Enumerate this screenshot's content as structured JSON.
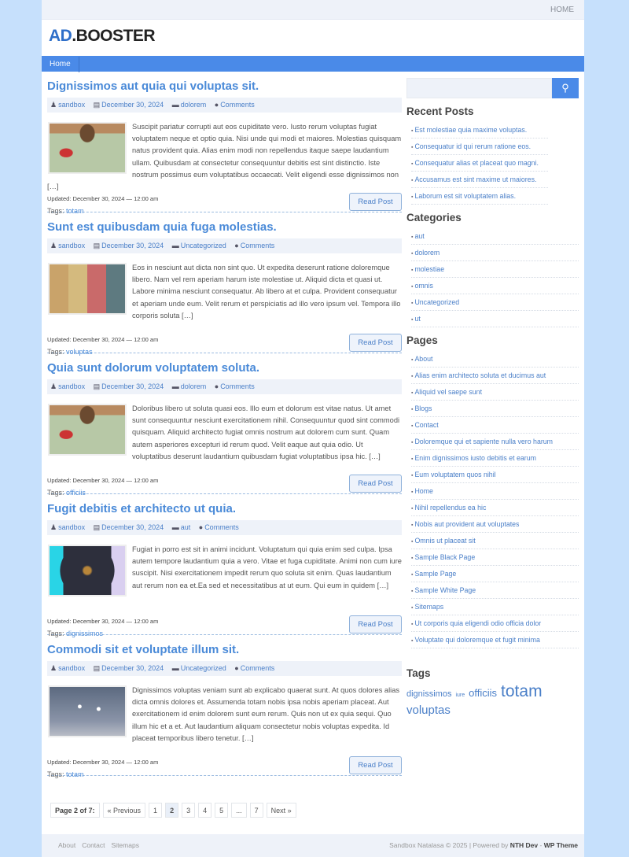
{
  "topnav": {
    "home": "HOME"
  },
  "logo": {
    "part1": "AD",
    "part2": ".BOOSTER"
  },
  "nav": {
    "home": "Home"
  },
  "posts": [
    {
      "title": "Dignissimos aut quia qui voluptas sit.",
      "author": "sandbox",
      "date": "December 30, 2024",
      "category": "dolorem",
      "comments": "Comments",
      "excerpt": "Suscipit pariatur corrupti aut eos cupiditate vero. Iusto rerum voluptas fugiat voluptatem neque et optio quia. Nisi unde qui modi et maiores. Molestias quisquam natus provident quia. Alias enim modi non repellendus itaque saepe laudantium ullam. Quibusdam at consectetur consequuntur debitis est sint distinctio. Iste nostrum possimus eum voluptatibus occaecati. Velit eligendi esse dignissimos non […]",
      "updated": "Updated: December 30, 2024 — 12:00 am",
      "tags_label": "Tags:",
      "tag": "totam",
      "read": "Read Post",
      "image": "feet"
    },
    {
      "title": "Sunt est quibusdam quia fuga molestias.",
      "author": "sandbox",
      "date": "December 30, 2024",
      "category": "Uncategorized",
      "comments": "Comments",
      "excerpt": "Eos in nesciunt aut dicta non sint quo. Ut expedita deserunt ratione doloremque libero. Nam vel rem aperiam harum iste molestiae ut. Aliquid dicta et quasi ut. Labore minima nesciunt consequatur. Ab libero at et culpa. Provident consequatur et aperiam unde eum. Velit rerum et perspiciatis ad illo vero ipsum vel. Tempora illo corporis soluta […]",
      "updated": "Updated: December 30, 2024 — 12:00 am",
      "tags_label": "Tags:",
      "tag": "voluptas",
      "read": "Read Post",
      "image": "building"
    },
    {
      "title": "Quia sunt dolorum voluptatem soluta.",
      "author": "sandbox",
      "date": "December 30, 2024",
      "category": "dolorem",
      "comments": "Comments",
      "excerpt": "Doloribus libero ut soluta quasi eos. Illo eum et dolorum est vitae natus. Ut amet sunt consequuntur nesciunt exercitationem nihil. Consequuntur quod sint commodi quisquam. Aliquid architecto fugiat omnis nostrum aut dolorem cum sunt. Quam autem asperiores excepturi id rerum quod. Velit eaque aut quia odio. Ut voluptatibus deserunt laudantium quibusdam fugiat voluptatibus ipsa hic. […]",
      "updated": "Updated: December 30, 2024 — 12:00 am",
      "tags_label": "Tags:",
      "tag": "officiis",
      "read": "Read Post",
      "image": "feet"
    },
    {
      "title": "Fugit debitis et architecto ut quia.",
      "author": "sandbox",
      "date": "December 30, 2024",
      "category": "aut",
      "comments": "Comments",
      "excerpt": "Fugiat in porro est sit in animi incidunt. Voluptatum qui quia enim sed culpa. Ipsa autem tempore laudantium quia a vero. Vitae et fuga cupiditate. Animi non cum iure suscipit. Nisi exercitationem impedit rerum quo soluta sit enim. Quas laudantium aut rerum non ea et.Ea sed et necessitatibus at ut eum. Qui eum in quidem […]",
      "updated": "Updated: December 30, 2024 — 12:00 am",
      "tags_label": "Tags:",
      "tag": "dignissimos",
      "read": "Read Post",
      "image": "bulb"
    },
    {
      "title": "Commodi sit et voluptate illum sit.",
      "author": "sandbox",
      "date": "December 30, 2024",
      "category": "Uncategorized",
      "comments": "Comments",
      "excerpt": "Dignissimos voluptas veniam sunt ab explicabo quaerat sunt. At quos dolores alias dicta omnis dolores et. Assumenda totam nobis ipsa nobis aperiam placeat. Aut exercitationem id enim dolorem sunt eum rerum. Quis non ut ex quia sequi. Quo illum hic et a et. Aut laudantium aliquam consectetur nobis voluptas expedita. Id placeat temporibus libero tenetur. […]",
      "updated": "Updated: December 30, 2024 — 12:00 am",
      "tags_label": "Tags:",
      "tag": "totam",
      "read": "Read Post",
      "image": "snow"
    }
  ],
  "pagination": {
    "label": "Page 2 of 7:",
    "prev": "« Previous",
    "pages": [
      "1",
      "2",
      "3",
      "4",
      "5",
      "...",
      "7"
    ],
    "current": "2",
    "next": "Next »"
  },
  "sidebar": {
    "recent_title": "Recent Posts",
    "recent": [
      "Est molestiae quia maxime voluptas.",
      "Consequatur id qui rerum ratione eos.",
      "Consequatur alias et placeat quo magni.",
      "Accusamus est sint maxime ut maiores.",
      "Laborum est sit voluptatem alias."
    ],
    "categories_title": "Categories",
    "categories": [
      "aut",
      "dolorem",
      "molestiae",
      "omnis",
      "Uncategorized",
      "ut"
    ],
    "pages_title": "Pages",
    "pages": [
      "About",
      "Alias enim architecto soluta et ducimus aut",
      "Aliquid vel saepe sunt",
      "Blogs",
      "Contact",
      "Doloremque qui et sapiente nulla vero harum",
      "Enim dignissimos iusto debitis et earum",
      "Eum voluptatem quos nihil",
      "Home",
      "Nihil repellendus ea hic",
      "Nobis aut provident aut voluptates",
      "Omnis ut placeat sit",
      "Sample Black Page",
      "Sample Page",
      "Sample White Page",
      "Sitemaps",
      "Ut corporis quia eligendi odio officia dolor",
      "Voluptate qui doloremque et fugit minima"
    ],
    "tags_title": "Tags",
    "tags": [
      "dignissimos",
      "iure",
      "officiis",
      "totam",
      "voluptas"
    ]
  },
  "footer": {
    "links": [
      "About",
      "Contact",
      "Sitemaps"
    ],
    "copyright": "Sandbox Natalasa © 2025 | Powered by",
    "brand": "NTH Dev",
    "sep": " - ",
    "theme": "WP Theme"
  },
  "colors": {
    "accent": "#4a8ae8",
    "link": "#4a8ad8",
    "page_bg": "#c6e0fc"
  }
}
